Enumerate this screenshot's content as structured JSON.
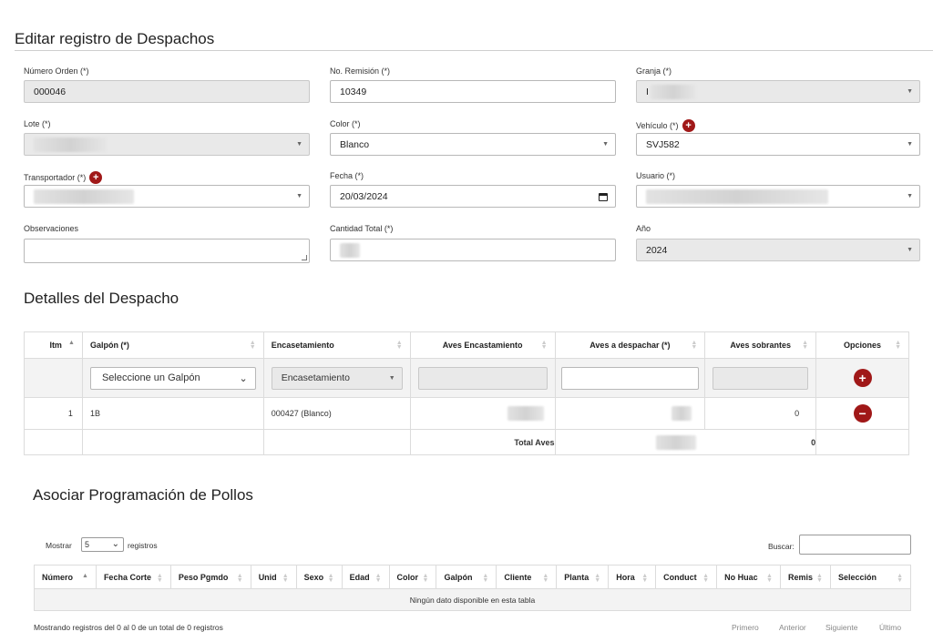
{
  "header": {
    "title": "Editar registro de Despachos"
  },
  "form": {
    "numero_orden": {
      "label": "Número Orden (*)",
      "value": "000046"
    },
    "no_remision": {
      "label": "No. Remisión (*)",
      "value": "10349"
    },
    "granja": {
      "label": "Granja (*)",
      "value": "I"
    },
    "lote": {
      "label": "Lote (*)"
    },
    "color": {
      "label": "Color (*)",
      "value": "Blanco"
    },
    "vehiculo": {
      "label": "Vehículo (*)",
      "value": "SVJ582"
    },
    "transportador": {
      "label": "Transportador (*)"
    },
    "fecha": {
      "label": "Fecha (*)",
      "value": "20/03/2024"
    },
    "usuario": {
      "label": "Usuario (*)"
    },
    "observaciones": {
      "label": "Observaciones"
    },
    "cantidad_total": {
      "label": "Cantidad Total (*)"
    },
    "anio": {
      "label": "Año",
      "value": "2024"
    }
  },
  "detalles": {
    "title": "Detalles del Despacho",
    "columns": [
      "Itm",
      "Galpón (*)",
      "Encasetamiento",
      "Aves Encastamiento",
      "Aves a despachar (*)",
      "Aves sobrantes",
      "Opciones"
    ],
    "galpon_placeholder": "Seleccione un Galpón",
    "encaset_placeholder": "Encasetamiento",
    "row": {
      "itm": "1",
      "galpon": "1B",
      "encasetamiento": "000427 (Blanco)",
      "sobrantes": "0"
    },
    "total_label": "Total Aves",
    "total_sobrantes": "0"
  },
  "programacion": {
    "title": "Asociar Programación de Pollos",
    "show_label": "Mostrar",
    "show_value": "5",
    "records_label": "registros",
    "search_label": "Buscar:",
    "columns": [
      "Número",
      "Fecha Corte",
      "Peso Pgmdo",
      "Unid",
      "Sexo",
      "Edad",
      "Color",
      "Galpón",
      "Cliente",
      "Planta",
      "Hora",
      "Conduct",
      "No Huac",
      "Remis",
      "Selección"
    ],
    "empty": "Ningún dato disponible en esta tabla",
    "info": "Mostrando registros del 0 al 0 de un total de 0 registros",
    "pager": {
      "first": "Primero",
      "prev": "Anterior",
      "next": "Siguiente",
      "last": "Último"
    }
  },
  "colors": {
    "accent": "#a01818",
    "border": "#b8b8b8",
    "disabled": "#e9e9e9"
  }
}
